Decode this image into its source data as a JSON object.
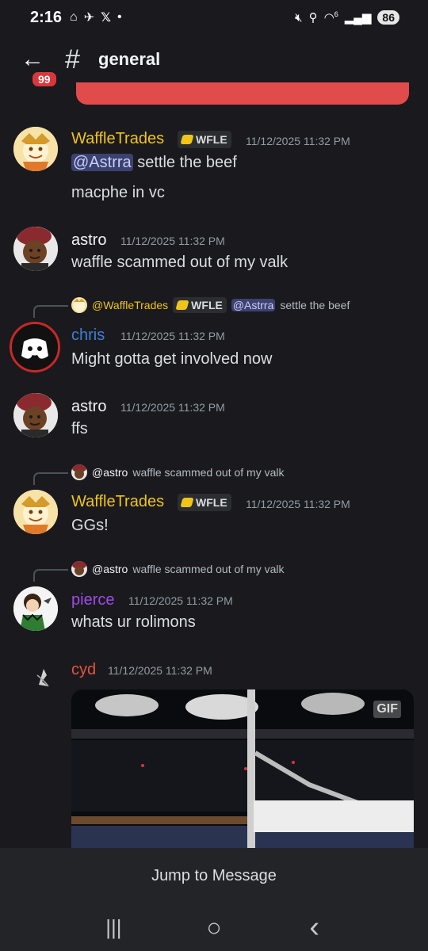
{
  "status_bar": {
    "time": "2:16",
    "battery": "86",
    "network": "6"
  },
  "header": {
    "badge": "99",
    "hash": "#",
    "channel": "general"
  },
  "messages": [
    {
      "username": "WaffleTrades",
      "tag": "WFLE",
      "timestamp": "11/12/2025 11:32 PM",
      "mention": "@Astrra",
      "text": " settle the beef",
      "text2": "macphe in vc"
    },
    {
      "username": "astro",
      "timestamp": "11/12/2025 11:32 PM",
      "text": "waffle scammed out of my valk"
    },
    {
      "reply_user": "@WaffleTrades",
      "reply_tag": "WFLE",
      "reply_mention": "@Astrra",
      "reply_text": "settle the beef",
      "username": "chris",
      "timestamp": "11/12/2025 11:32 PM",
      "text": "Might gotta get involved now"
    },
    {
      "username": "astro",
      "timestamp": "11/12/2025 11:32 PM",
      "text": "ffs"
    },
    {
      "reply_user": "@astro",
      "reply_text": "waffle scammed out of my valk",
      "username": "WaffleTrades",
      "tag": "WFLE",
      "timestamp": "11/12/2025 11:32 PM",
      "text": "GGs!"
    },
    {
      "reply_user": "@astro",
      "reply_text": "waffle scammed out of my valk",
      "username": "pierce",
      "timestamp": "11/12/2025 11:32 PM",
      "text": "whats ur rolimons"
    },
    {
      "username": "cyd",
      "timestamp": "11/12/2025 11:32 PM",
      "gif_label": "GIF"
    }
  ],
  "jump_label": "Jump to Message",
  "nav": {
    "recents": "|||",
    "home": "○",
    "back": "‹"
  },
  "colors": {
    "waffle": "#f0c419",
    "chris": "#3d7fd4",
    "pierce": "#a349ea",
    "cyd": "#e5533d",
    "astro": "#f2f3f5",
    "mention_bg": "#3c4270"
  }
}
